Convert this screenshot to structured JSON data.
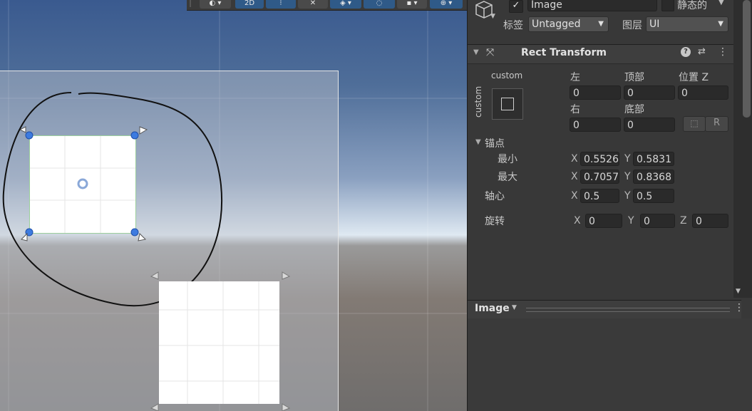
{
  "inspector": {
    "object_name": "Image",
    "static_label": "静态的",
    "tag_label": "标签",
    "tag_value": "Untagged",
    "layer_label": "图层",
    "layer_value": "UI",
    "rect_transform": {
      "title": "Rect Transform",
      "anchor_preset_label": "custom",
      "anchor_preset_side": "custom",
      "left_label": "左",
      "top_label": "顶部",
      "posz_label": "位置 Z",
      "left_value": "0",
      "top_value": "0",
      "posz_value": "0",
      "right_label": "右",
      "bottom_label": "底部",
      "right_value": "0",
      "bottom_value": "0",
      "anchors_label": "锚点",
      "min_label": "最小",
      "max_label": "最大",
      "min_x": "0.5526",
      "min_y": "0.5831",
      "max_x": "0.7057",
      "max_y": "0.8368",
      "pivot_label": "轴心",
      "pivot_x": "0.5",
      "pivot_y": "0.5",
      "rotation_label": "旋转",
      "rot_x": "0",
      "rot_y": "0",
      "rot_z": "0"
    },
    "image_component_label": "Image",
    "axis": {
      "x": "X",
      "y": "Y",
      "z": "Z"
    },
    "r_button": "R"
  },
  "toolbar": {
    "mode_2d": "2D"
  }
}
